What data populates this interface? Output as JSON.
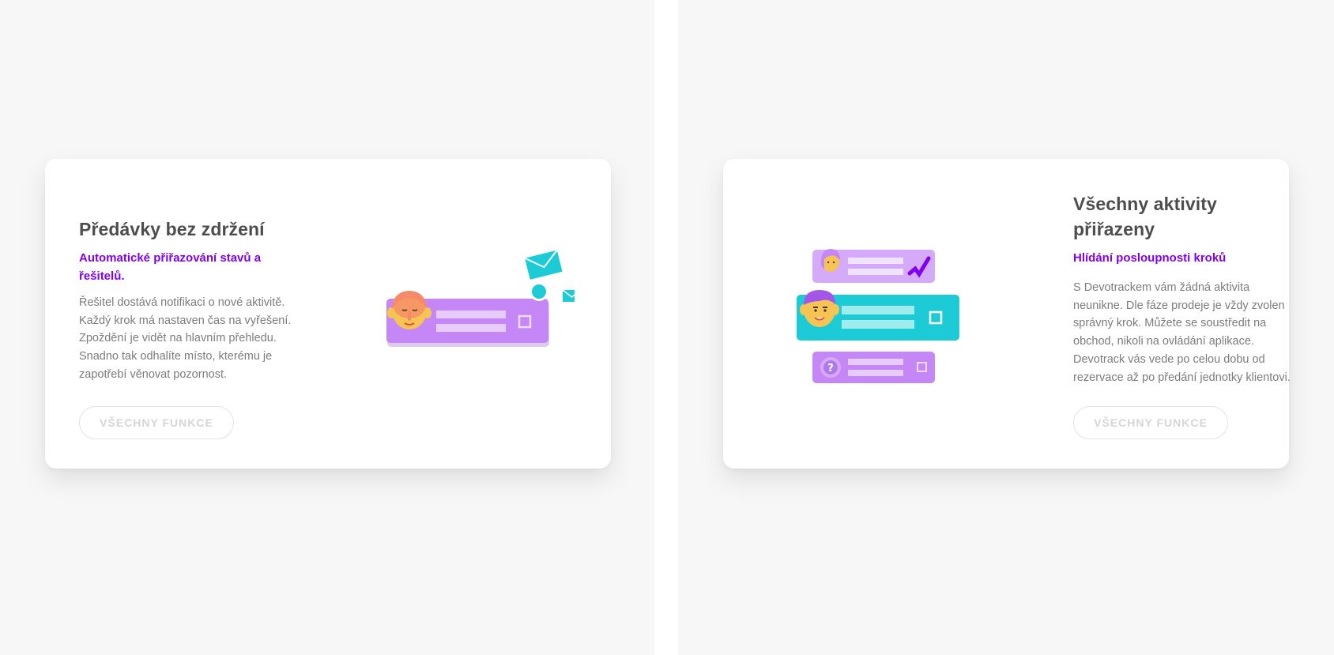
{
  "colors": {
    "background": "#f7f7f7",
    "card": "#ffffff",
    "title": "#4d4d4d",
    "accent_purple": "#8000f0",
    "body_text": "#7c7c7c",
    "button_border": "#e3e3e3",
    "button_text": "#d5d5d5",
    "illustration_purple": "#c586f6",
    "illustration_light_purple": "#d5aaf8",
    "illustration_cyan": "#1ccbd6"
  },
  "cards": [
    {
      "title": "Předávky bez zdržení",
      "subtitle": "Automatické přiřazování stavů a řešitelů.",
      "body": "Řešitel dostává notifikaci o nové aktivitě. Každý krok má nastaven čas na vyřešení. Zpoždění je vidět na hlavním přehledu. Snadno tak odhalíte místo, kterému je zapotřebí věnovat pozornost.",
      "button_label": "VŠECHNY FUNKCE",
      "illustration_icons": [
        "person-avatar-icon",
        "task-card-icon",
        "envelope-icon",
        "notification-dot-icon",
        "checkbox-icon"
      ]
    },
    {
      "title": "Všechny aktivity přiřazeny",
      "subtitle": "Hlídání posloupnosti kroků",
      "body": "S Devotrackem vám žádná aktivita neunikne. Dle fáze prodeje je vždy zvolen správný krok. Můžete se soustředit na obchod, nikoli na ovládání aplikace. Devotrack vás vede po celou dobu od rezervace až po předání jednotky klientovi.",
      "button_label": "VŠECHNY FUNKCE",
      "illustration_icons": [
        "person-avatar-icon",
        "checkmark-icon",
        "task-card-icon",
        "question-mark-icon",
        "checkbox-icon"
      ]
    }
  ]
}
